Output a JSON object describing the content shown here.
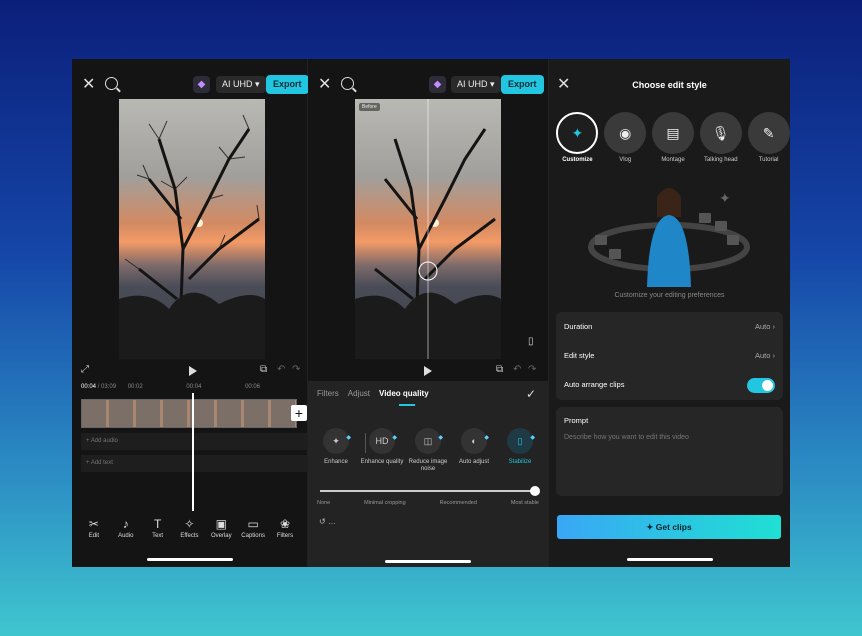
{
  "editor": {
    "quality": "AI UHD",
    "export": "Export",
    "time_current": "00:04",
    "time_total": "/ 03:09",
    "ruler": [
      "00:02",
      "00:04",
      "00:06"
    ],
    "add_audio": "Add audio",
    "add_text": "Add text",
    "tools": [
      {
        "icon": "scissors-icon",
        "label": "Edit"
      },
      {
        "icon": "music-note-icon",
        "label": "Audio"
      },
      {
        "icon": "text-icon",
        "label": "Text"
      },
      {
        "icon": "sparkle-icon",
        "label": "Effects"
      },
      {
        "icon": "overlay-icon",
        "label": "Overlay"
      },
      {
        "icon": "captions-icon",
        "label": "Captions"
      },
      {
        "icon": "filters-icon",
        "label": "Filters"
      }
    ]
  },
  "quality_panel": {
    "before_badge": "Before",
    "tabs": [
      "Filters",
      "Adjust",
      "Video quality"
    ],
    "options": [
      {
        "label": "Enhance",
        "glyph": "✦"
      },
      {
        "label": "Enhance quality",
        "glyph": "HD"
      },
      {
        "label": "Reduce image noise",
        "glyph": "◫"
      },
      {
        "label": "Auto adjust",
        "glyph": "◐"
      },
      {
        "label": "Stabilize",
        "glyph": "▯"
      }
    ],
    "slider_labels": [
      "None",
      "Minimal cropping",
      "Recommended",
      "Most stable"
    ],
    "slider_level": 1.0
  },
  "style_panel": {
    "title": "Choose edit style",
    "styles": [
      {
        "label": "Customize",
        "glyph": "✦"
      },
      {
        "label": "Vlog",
        "glyph": "◉"
      },
      {
        "label": "Montage",
        "glyph": "▤"
      },
      {
        "label": "Talking head",
        "glyph": "🎙"
      },
      {
        "label": "Tutorial",
        "glyph": "✎"
      }
    ],
    "hint": "Customize your editing preferences",
    "duration_label": "Duration",
    "duration_value": "Auto",
    "edit_style_label": "Edit style",
    "edit_style_value": "Auto",
    "auto_arrange_label": "Auto arrange clips",
    "auto_arrange_on": true,
    "prompt_label": "Prompt",
    "prompt_placeholder": "Describe how you want to edit this video",
    "cta": "Get clips"
  },
  "colors": {
    "accent": "#22c6e0",
    "gem": "#c58cff"
  }
}
